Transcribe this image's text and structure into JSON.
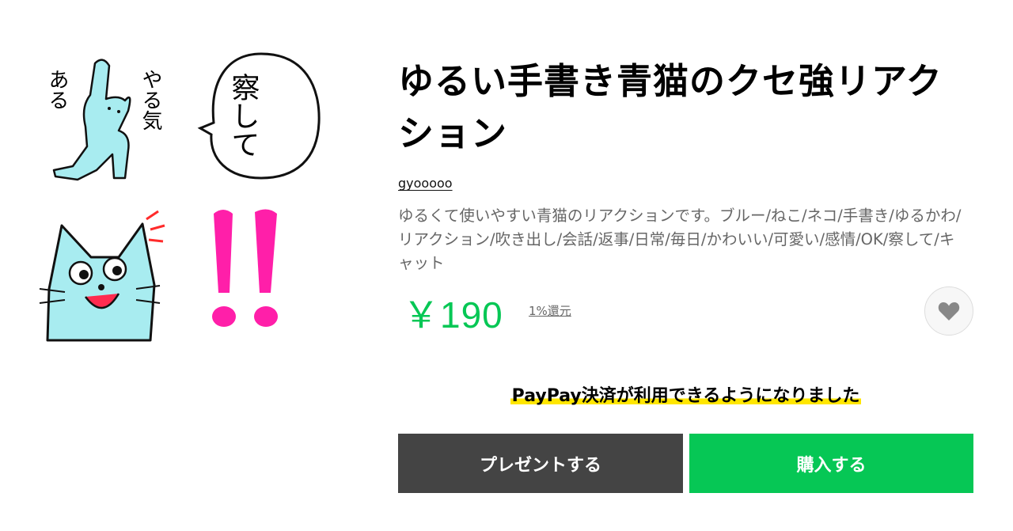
{
  "product": {
    "title": "ゆるい手書き青猫のクセ強リアクション",
    "author": "gyooooo",
    "description": "ゆるくて使いやすい青猫のリアクションです。ブルー/ねこ/ネコ/手書き/ゆるかわ/リアクション/吹き出し/会話/返事/日常/毎日/かわいい/可愛い/感情/OK/察して/キャット",
    "price": "￥190",
    "cashback": "1%還元"
  },
  "stickers": {
    "items": [
      {
        "icon": "stretching-cat-sticker",
        "text_left": "ある",
        "text_right": "やる気"
      },
      {
        "icon": "speech-bubble-sticker",
        "text": "察して"
      },
      {
        "icon": "laughing-cat-sticker"
      },
      {
        "icon": "double-exclamation-sticker"
      }
    ]
  },
  "favorite": {
    "icon": "heart-icon"
  },
  "notice": {
    "text": "PayPay決済が利用できるようになりました"
  },
  "actions": {
    "gift_label": "プレゼントする",
    "buy_label": "購入する"
  },
  "colors": {
    "accent": "#06c755",
    "gift_button": "#444444",
    "highlight": "#ffe600",
    "cat": "#a8ecf0",
    "exclaim": "#ff1fa9"
  }
}
